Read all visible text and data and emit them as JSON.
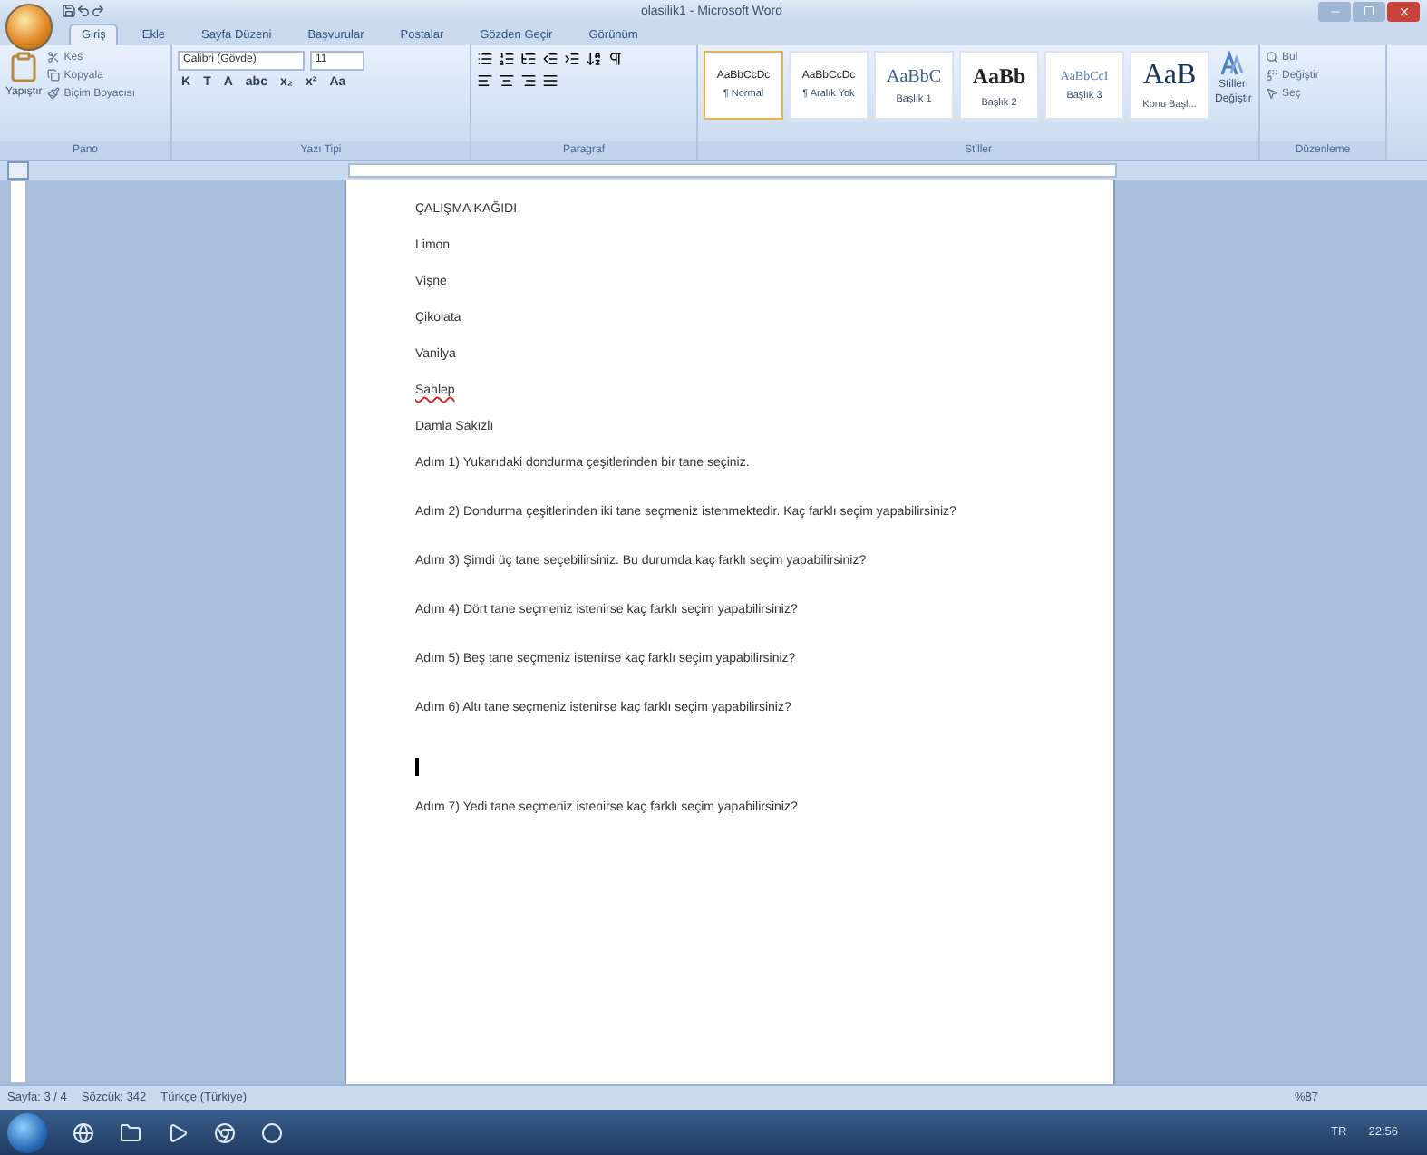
{
  "window": {
    "title": "olasilik1 - Microsoft Word"
  },
  "tabs": [
    {
      "label": "Giriş",
      "selected": true
    },
    {
      "label": "Ekle",
      "selected": false
    },
    {
      "label": "Sayfa Düzeni",
      "selected": false
    },
    {
      "label": "Başvurular",
      "selected": false
    },
    {
      "label": "Postalar",
      "selected": false
    },
    {
      "label": "Gözden Geçir",
      "selected": false
    },
    {
      "label": "Görünüm",
      "selected": false
    }
  ],
  "clipboard": {
    "paste": "Yapıştır",
    "items": [
      "Kes",
      "Kopyala",
      "Biçim Boyacısı"
    ],
    "label": "Pano"
  },
  "font": {
    "name": "Calibri (Gövde)",
    "size": "11",
    "buttons": [
      "K",
      "T",
      "A",
      "abc",
      "x₂",
      "x²",
      "Aa"
    ],
    "label": "Yazı Tipi"
  },
  "paragraph": {
    "label": "Paragraf"
  },
  "styles": {
    "label": "Stiller",
    "items": [
      {
        "kind": "normal",
        "preview": "AaBbCcDc",
        "name": "¶ Normal",
        "selected": true
      },
      {
        "kind": "normal",
        "preview": "AaBbCcDc",
        "name": "¶ Aralık Yok",
        "selected": false
      },
      {
        "kind": "heading1",
        "preview": "AaBbC",
        "name": "Başlık 1",
        "selected": false
      },
      {
        "kind": "heading2",
        "preview": "AaBb",
        "name": "Başlık 2",
        "selected": false
      },
      {
        "kind": "heading3",
        "preview": "AaBbCcI",
        "name": "Başlık 3",
        "selected": false
      },
      {
        "kind": "title",
        "preview": "AaB",
        "name": "Konu Başl...",
        "selected": false
      }
    ],
    "change": [
      "Stilleri",
      "Değiştir"
    ]
  },
  "editing": {
    "label": "Düzenleme",
    "items": [
      "Bul",
      "Değiştir",
      "Seç"
    ]
  },
  "document": {
    "paragraphs": [
      {
        "kind": "line",
        "text": "ÇALIŞMA KAĞIDI",
        "misspelled": false
      },
      {
        "kind": "line",
        "text": "Limon",
        "misspelled": false
      },
      {
        "kind": "line",
        "text": "Vişne",
        "misspelled": false
      },
      {
        "kind": "line",
        "text": "Çikolata",
        "misspelled": false
      },
      {
        "kind": "line",
        "text": "Vanilya",
        "misspelled": false
      },
      {
        "kind": "line",
        "text": "Sahlep",
        "misspelled": true
      },
      {
        "kind": "line",
        "text": "Damla Sakızlı",
        "misspelled": false
      },
      {
        "kind": "question",
        "text": "Adım 1) Yukarıdaki dondurma çeşitlerinden bir tane seçiniz.",
        "misspelled": false
      },
      {
        "kind": "question",
        "text": "Adım 2) Dondurma çeşitlerinden iki tane seçmeniz istenmektedir. Kaç farklı seçim yapabilirsiniz?",
        "misspelled": false
      },
      {
        "kind": "question",
        "text": "Adım 3) Şimdi üç tane seçebilirsiniz. Bu durumda kaç farklı seçim yapabilirsiniz?",
        "misspelled": false
      },
      {
        "kind": "question",
        "text": "Adım 4) Dört tane seçmeniz istenirse kaç farklı seçim yapabilirsiniz?",
        "misspelled": false
      },
      {
        "kind": "question",
        "text": "Adım 5) Beş tane seçmeniz istenirse kaç farklı seçim yapabilirsiniz?",
        "misspelled": false
      },
      {
        "kind": "question",
        "text": "Adım 6) Altı tane seçmeniz istenirse kaç farklı seçim yapabilirsiniz?",
        "misspelled": false
      },
      {
        "kind": "caret"
      },
      {
        "kind": "line",
        "text": "Adım 7) Yedi tane seçmeniz istenirse kaç farklı seçim yapabilirsiniz?",
        "misspelled": false
      }
    ]
  },
  "status_bar": {
    "page": "Sayfa: 3 / 4",
    "words": "Sözcük: 342",
    "language": "Türkçe (Türkiye)",
    "zoom": "%87"
  },
  "taskbar": {
    "language": "TR",
    "clock": "22:56"
  }
}
